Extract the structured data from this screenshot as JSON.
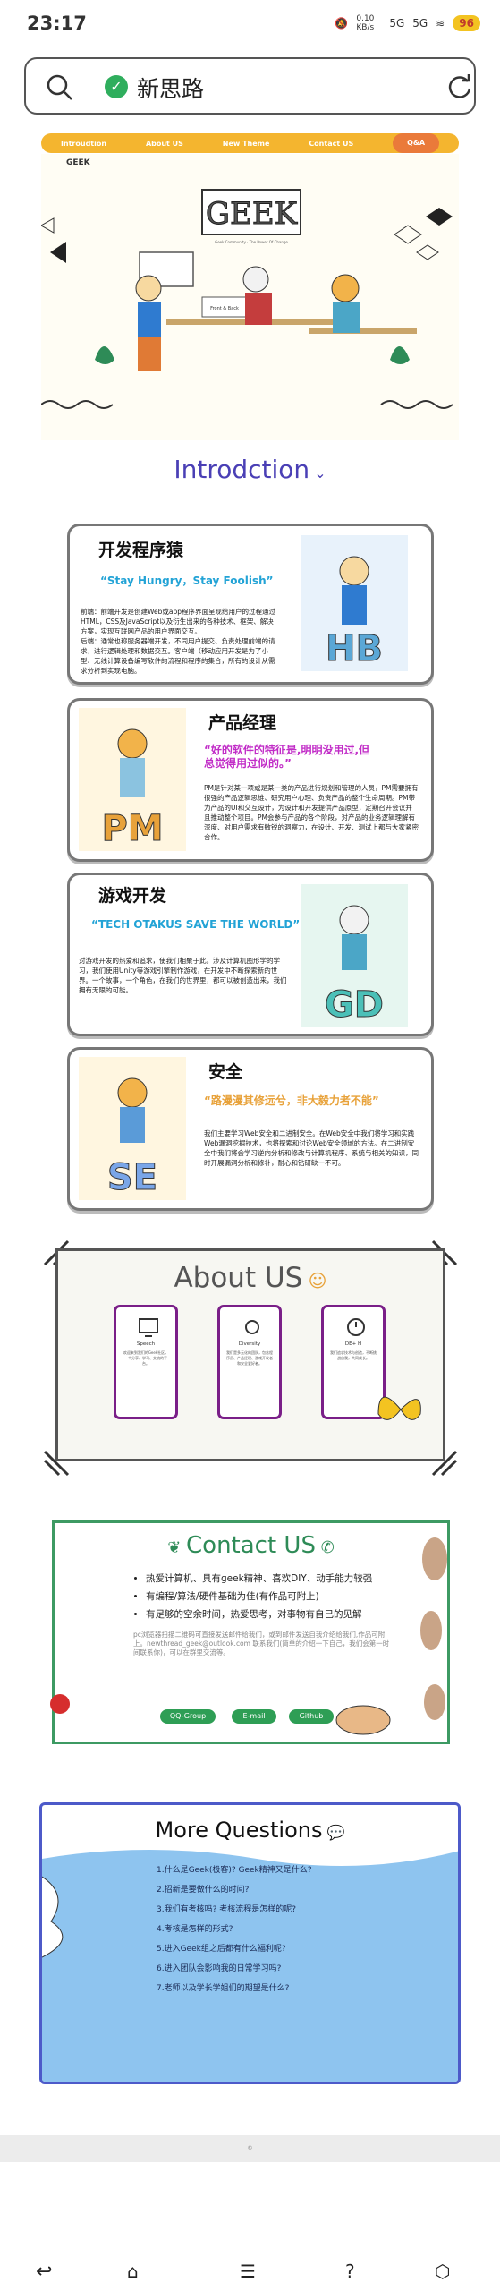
{
  "status": {
    "time": "23:17",
    "net": "0.10 KB/s",
    "signal1": "5G",
    "signal2": "5G",
    "battery": "96"
  },
  "browser": {
    "title": "新思路"
  },
  "nav": [
    "Introudtion",
    "About US",
    "New Theme",
    "Contact US",
    "Q&A"
  ],
  "hero": {
    "logo": "GEEK",
    "tagline": "Geek Community · The Power Of Change",
    "board": "Front & Back"
  },
  "intro_title": "Introdction",
  "cards": [
    {
      "title": "开发程序猿",
      "quote": "“Stay Hungry，Stay Foolish”",
      "quote_color": "#22a3d6",
      "desc": "前端：前端开发是创建Web或app程序界面呈现给用户的过程通过HTML，CSS及JavaScript以及衍生出来的各种技术、框架、解决方案，实现互联网产品的用户界面交互。\n后端：通常也称服务器端开发，不同用户提交、负责处理前端的请求，进行逻辑处理和数据交互。客户端（移动应用开发是为了小型、无线计算设备编写软件的流程和程序的集合，所有的设计从需求分析到实现电脑。",
      "letters": "HB"
    },
    {
      "title": "产品经理",
      "quote": "“好的软件的特征是,明明没用过,但总觉得用过似的。”",
      "quote_color": "#c12cc7",
      "desc": "PM是针对某一项或是某一类的产品进行规划和管理的人员，PM需要拥有很强的产品逻辑思维、研究用户心理、负责产品的整个生命周期。PM带为产品的UI和交互设计，为设计和开发提供产品原型，定期召开会议并且推动整个项目。PM会参与产品的各个阶段，对产品的业务逻辑理解有深度、对用户需求有敏锐的洞察力，在设计、开发、测试上都与大家紧密合作。",
      "letters": "PM"
    },
    {
      "title": "游戏开发",
      "quote": "“TECH OTAKUS SAVE THE WORLD”",
      "quote_color": "#22a3d6",
      "desc": "对游戏开发的热爱和追求，使我们相聚于此。涉及计算机图形学的学习，我们使用Unity等游戏引擎制作游戏，在开发中不断探索新的世界。一个故事，一个角色，在我们的世界里，都可以被创造出来，我们拥有无限的可能。",
      "letters": "GD"
    },
    {
      "title": "安全",
      "quote": "“路漫漫其修远兮，非大毅力者不能”",
      "quote_color": "#e8a23a",
      "desc": "我们主要学习Web安全和二进制安全。在Web安全中我们将学习和实践Web漏洞挖掘技术，也将探索和讨论Web安全领域的方法。在二进制安全中我们将会学习逆向分析和修改与计算机程序、系统与相关的知识，同时开展漏洞分析和修补，耐心和钻研缺一不可。",
      "letters": "SE"
    }
  ],
  "about": {
    "title": "About US",
    "cards": [
      {
        "label": "Speech",
        "text": "欢迎来到我们的Geek社区，一个分享、学习、交流的平台。"
      },
      {
        "label": "Diversity",
        "text": "我们是多元化的团队，包含程序员、产品经理、游戏开发者和安全爱好者。"
      },
      {
        "label": "DE+ H",
        "text": "我们追求技术与创造，不断挑战自我，共同成长。"
      }
    ]
  },
  "contact": {
    "title": "Contact US",
    "items": [
      "热爱计算机、具有geek精神、喜欢DIY、动手能力较强",
      "有编程/算法/硬件基础为佳(有作品可附上)",
      "有足够的空余时间，热爱思考，对事物有自己的见解"
    ],
    "note": "pc浏览器扫描二维码可直接发送邮件给我们，或到邮件发送自我介绍给我们,作品可附上。newthread_geek@outlook.com 联系我们(简单的介绍一下自己，我们会第一时间联系你)，可以在群里交流等。",
    "buttons": [
      "QQ-Group",
      "E-mail",
      "Github"
    ]
  },
  "questions": {
    "title": "More Questions",
    "items": [
      "1.什么是Geek(极客)? Geek精神又是什么?",
      "2.招新是要做什么的时间?",
      "3.我们有考核吗? 考核流程是怎样的呢?",
      "4.考核是怎样的形式?",
      "5.进入Geek组之后都有什么福利呢?",
      "6.进入团队会影响我的日常学习吗?",
      "7.老师以及学长学姐们的期望是什么?"
    ]
  },
  "footer": "©"
}
